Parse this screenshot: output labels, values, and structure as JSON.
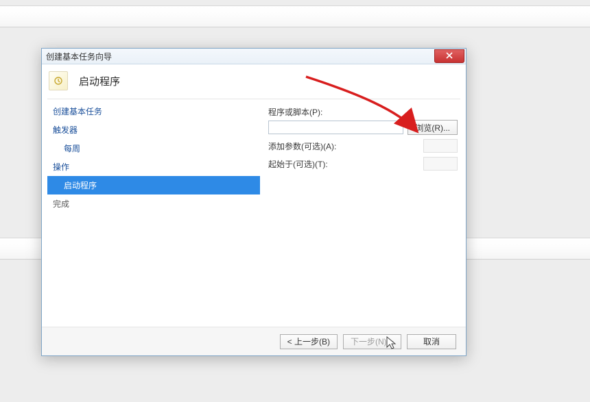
{
  "window": {
    "title": "创建基本任务向导"
  },
  "header": {
    "title": "启动程序"
  },
  "sidebar": {
    "items": [
      {
        "label": "创建基本任务"
      },
      {
        "label": "触发器"
      },
      {
        "label": "每周"
      },
      {
        "label": "操作"
      },
      {
        "label": "启动程序"
      },
      {
        "label": "完成"
      }
    ]
  },
  "form": {
    "program_label": "程序或脚本(P):",
    "program_value": "",
    "browse_label": "浏览(R)...",
    "args_label": "添加参数(可选)(A):",
    "args_value": "",
    "startin_label": "起始于(可选)(T):",
    "startin_value": ""
  },
  "footer": {
    "back": "< 上一步(B)",
    "next": "下一步(N) >",
    "cancel": "取消"
  },
  "colors": {
    "accent": "#2e8ae6",
    "annotation": "#d81e1e"
  }
}
